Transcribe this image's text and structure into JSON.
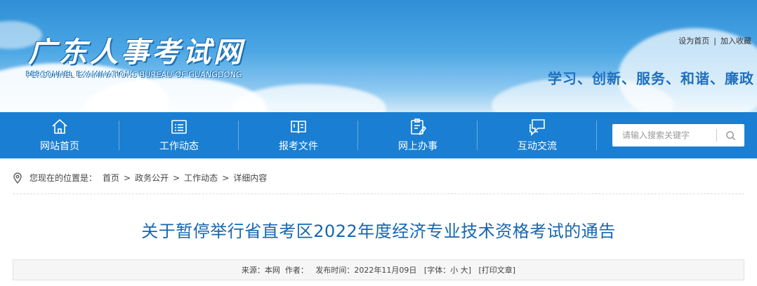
{
  "header": {
    "logo_cn": "广东人事考试网",
    "logo_en": "PERSONNEL EXAMINATIONS BUREAU OF GUANGDONG",
    "set_home": "设为首页",
    "separator": "|",
    "add_favorite": "加入收藏",
    "slogan": "学习、创新、服务、和谐、廉政"
  },
  "nav": {
    "items": [
      {
        "label": "网站首页",
        "icon": "home-icon"
      },
      {
        "label": "工作动态",
        "icon": "news-list-icon"
      },
      {
        "label": "报考文件",
        "icon": "open-book-icon"
      },
      {
        "label": "网上办事",
        "icon": "clipboard-pen-icon"
      },
      {
        "label": "互动交流",
        "icon": "chat-bubbles-icon"
      }
    ],
    "search_placeholder": "请输入搜索关键字"
  },
  "breadcrumb": {
    "prefix": "您现在的位置是：",
    "items": [
      "首页",
      "政务公开",
      "工作动态",
      "详细内容"
    ],
    "arrow": ">"
  },
  "article": {
    "title": "关于暂停举行省直考区2022年度经济专业技术资格考试的通告",
    "meta": {
      "source": "来源：本网",
      "author": "作者：",
      "publish_time": "发布时间：2022年11月09日",
      "font_label": "[字体：",
      "font_small": "小",
      "font_large": "大",
      "font_close": "]",
      "print": "[打印文章]"
    }
  },
  "colors": {
    "nav_bg": "#1a7fd2",
    "title": "#1766b0",
    "slogan": "#1f6fc0"
  }
}
